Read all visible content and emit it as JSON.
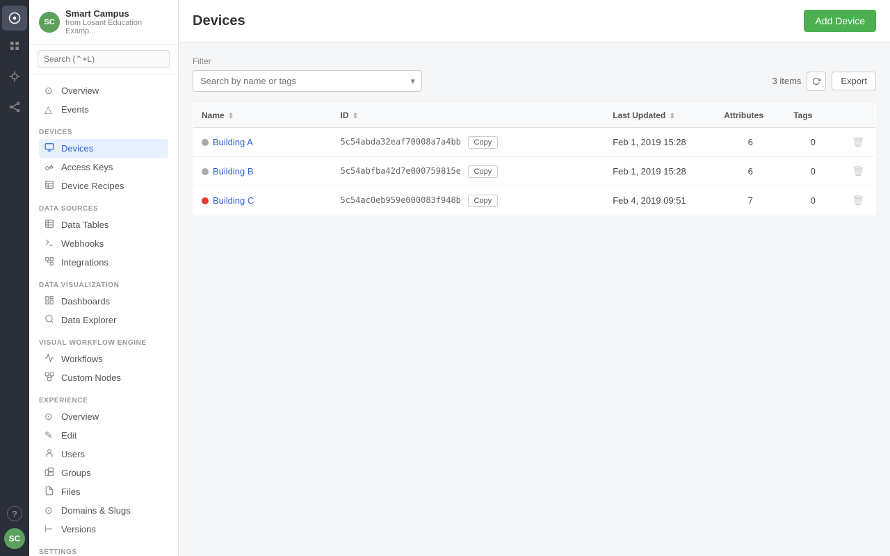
{
  "app": {
    "name": "Smart Campus",
    "subtitle": "from Losant Education Examp...",
    "avatar_initials": "SC"
  },
  "sidebar_search": {
    "placeholder": "Search (⌃+L)"
  },
  "nav": {
    "top_items": [
      {
        "id": "overview",
        "label": "Overview",
        "icon": "⊙"
      },
      {
        "id": "events",
        "label": "Events",
        "icon": "△"
      }
    ],
    "devices_section": {
      "title": "Devices",
      "items": [
        {
          "id": "devices",
          "label": "Devices",
          "icon": "⊞",
          "active": true
        },
        {
          "id": "access-keys",
          "label": "Access Keys",
          "icon": "⊹"
        },
        {
          "id": "device-recipes",
          "label": "Device Recipes",
          "icon": "⊟"
        }
      ]
    },
    "data_sources_section": {
      "title": "Data Sources",
      "items": [
        {
          "id": "data-tables",
          "label": "Data Tables",
          "icon": "⊞"
        },
        {
          "id": "webhooks",
          "label": "Webhooks",
          "icon": "△"
        },
        {
          "id": "integrations",
          "label": "Integrations",
          "icon": "⊟"
        }
      ]
    },
    "data_viz_section": {
      "title": "Data Visualization",
      "items": [
        {
          "id": "dashboards",
          "label": "Dashboards",
          "icon": "⊞"
        },
        {
          "id": "data-explorer",
          "label": "Data Explorer",
          "icon": "◎"
        }
      ]
    },
    "workflow_section": {
      "title": "Visual Workflow Engine",
      "items": [
        {
          "id": "workflows",
          "label": "Workflows",
          "icon": "⊹"
        },
        {
          "id": "custom-nodes",
          "label": "Custom Nodes",
          "icon": "⊟"
        }
      ]
    },
    "experience_section": {
      "title": "Experience",
      "items": [
        {
          "id": "exp-overview",
          "label": "Overview",
          "icon": "⊙"
        },
        {
          "id": "edit",
          "label": "Edit",
          "icon": "✎"
        },
        {
          "id": "users",
          "label": "Users",
          "icon": "○"
        },
        {
          "id": "groups",
          "label": "Groups",
          "icon": "⊞"
        },
        {
          "id": "files",
          "label": "Files",
          "icon": "▭"
        },
        {
          "id": "domains-slugs",
          "label": "Domains & Slugs",
          "icon": "⊙"
        },
        {
          "id": "versions",
          "label": "Versions",
          "icon": "⊢"
        }
      ]
    },
    "settings_section": {
      "title": "Settings"
    }
  },
  "main": {
    "title": "Devices",
    "add_button_label": "Add Device",
    "filter_label": "Filter",
    "filter_placeholder": "Search by name or tags",
    "items_count": "3 items",
    "export_label": "Export",
    "table": {
      "columns": [
        "Name",
        "ID",
        "Last Updated",
        "Attributes",
        "Tags"
      ],
      "rows": [
        {
          "name": "Building A",
          "status_color": "#aaa",
          "id": "5c54abda32eaf70008a7a4bb",
          "last_updated": "Feb 1, 2019 15:28",
          "attributes": "6",
          "tags": "0"
        },
        {
          "name": "Building B",
          "status_color": "#aaa",
          "id": "5c54abfba42d7e000759815e",
          "last_updated": "Feb 1, 2019 15:28",
          "attributes": "6",
          "tags": "0"
        },
        {
          "name": "Building C",
          "status_color": "#e53935",
          "id": "5c54ac0eb959e000083f948b",
          "last_updated": "Feb 4, 2019 09:51",
          "attributes": "7",
          "tags": "0"
        }
      ]
    }
  },
  "iconbar": {
    "items": [
      {
        "id": "home",
        "icon": "⊕",
        "active": true
      },
      {
        "id": "grid",
        "icon": "⊞"
      },
      {
        "id": "circuit",
        "icon": "⊗"
      },
      {
        "id": "nodes",
        "icon": "⊛"
      }
    ],
    "bottom_items": [
      {
        "id": "help",
        "icon": "?"
      },
      {
        "id": "user-avatar",
        "label": "SC"
      }
    ]
  },
  "copy_label": "Copy"
}
